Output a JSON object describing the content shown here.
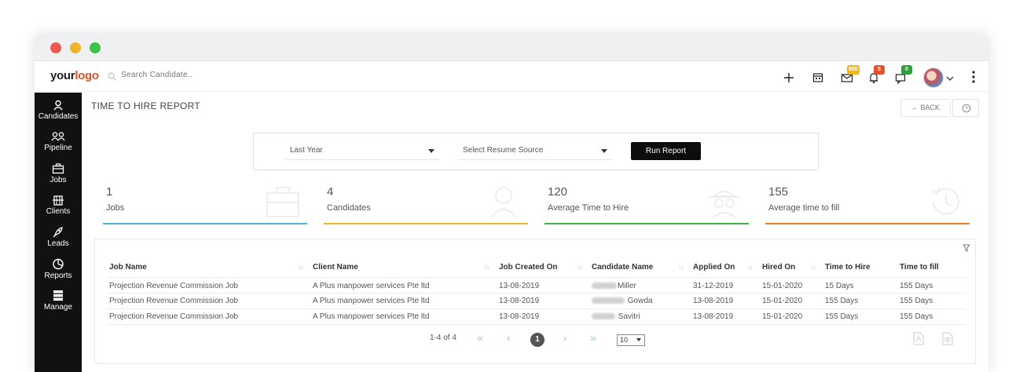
{
  "logo": {
    "part1": "your",
    "part2": "logo"
  },
  "search": {
    "placeholder": "Search Candidate.."
  },
  "header": {
    "mail_badge": "800",
    "bell_badge": "5",
    "chat_badge": "0",
    "colors": {
      "mail_badge": "#f0b429",
      "bell_badge": "#e2522c",
      "chat_badge": "#2e9e3e"
    }
  },
  "sidebar": {
    "items": [
      {
        "label": "Candidates",
        "icon": "person-icon"
      },
      {
        "label": "Pipeline",
        "icon": "people-icon"
      },
      {
        "label": "Jobs",
        "icon": "briefcase-icon"
      },
      {
        "label": "Clients",
        "icon": "building-icon"
      },
      {
        "label": "Leads",
        "icon": "rocket-icon"
      },
      {
        "label": "Reports",
        "icon": "pie-chart-icon"
      },
      {
        "label": "Manage",
        "icon": "server-icon"
      }
    ]
  },
  "page": {
    "title": "TIME TO HIRE REPORT",
    "back_label": "BACK"
  },
  "filters": {
    "period": "Last Year",
    "resume_source": "Select Resume Source",
    "run_label": "Run Report"
  },
  "stats": [
    {
      "value": "1",
      "label": "Jobs",
      "color": "#4fb3dc",
      "icon": "briefcase-icon"
    },
    {
      "value": "4",
      "label": "Candidates",
      "color": "#f0b429",
      "icon": "person-icon"
    },
    {
      "value": "120",
      "label": "Average Time to Hire",
      "color": "#3bb54a",
      "icon": "spy-icon"
    },
    {
      "value": "155",
      "label": "Average time to fill",
      "color": "#f07c22",
      "icon": "history-icon"
    }
  ],
  "table": {
    "columns": [
      "Job Name",
      "Client Name",
      "Job Created On",
      "Candidate Name",
      "Applied On",
      "Hired On",
      "Time to Hire",
      "Time to fill"
    ],
    "rows": [
      {
        "job": "Projection Revenue Commission Job",
        "client": "A Plus manpower services Pte ltd",
        "created": "13-08-2019",
        "candidate": "Miller",
        "applied": "31-12-2019",
        "hired": "15-01-2020",
        "tth": "15 Days",
        "ttf": "155 Days"
      },
      {
        "job": "Projection Revenue Commission Job",
        "client": "A Plus manpower services Pte ltd",
        "created": "13-08-2019",
        "candidate": "Gowda",
        "applied": "13-08-2019",
        "hired": "15-01-2020",
        "tth": "155 Days",
        "ttf": "155 Days"
      },
      {
        "job": "Projection Revenue Commission Job",
        "client": "A Plus manpower services Pte ltd",
        "created": "13-08-2019",
        "candidate": "Savitri",
        "applied": "13-08-2019",
        "hired": "15-01-2020",
        "tth": "155 Days",
        "ttf": "155 Days"
      }
    ]
  },
  "pagination": {
    "range": "1-4 of 4",
    "current_page": "1",
    "page_size": "10"
  }
}
